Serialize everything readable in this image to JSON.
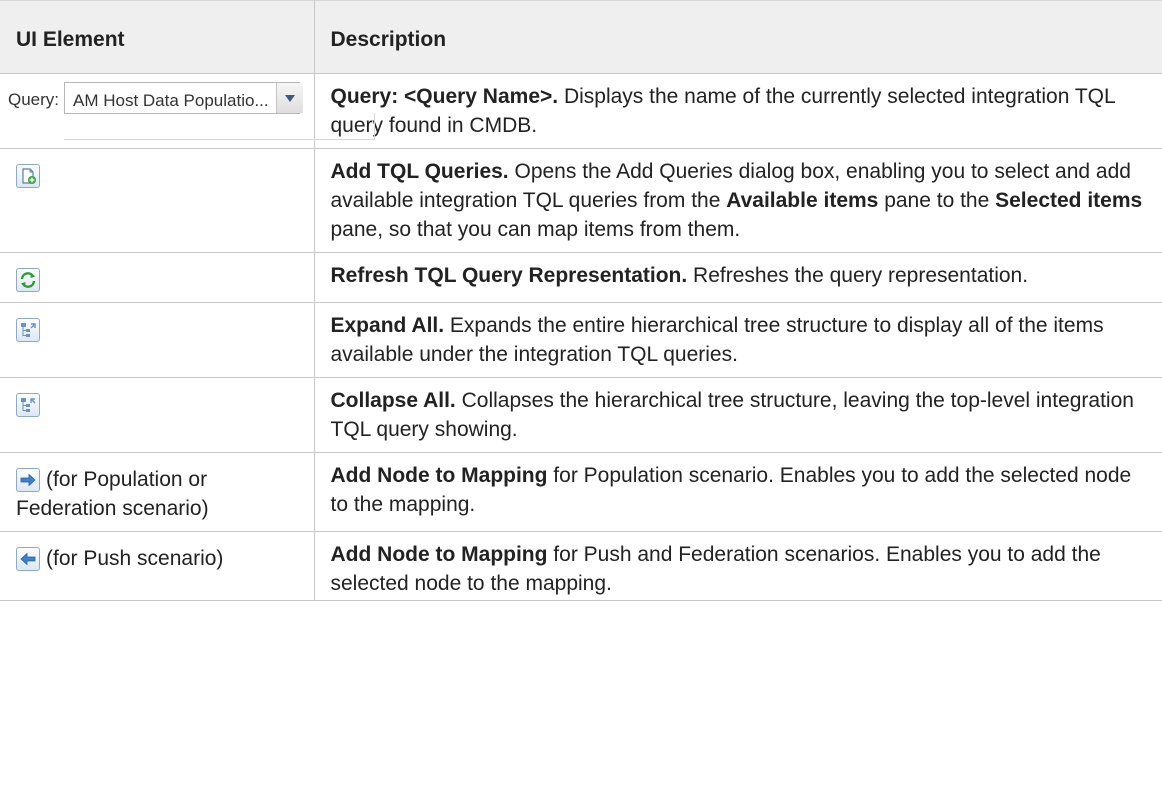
{
  "header": {
    "col1": "UI Element",
    "col2": "Description"
  },
  "query": {
    "label": "Query:",
    "value": "AM Host Data Populatio...",
    "title": "Query: <Query Name>.",
    "desc": " Displays the name of the currently selected integration TQL query found in CMDB."
  },
  "rows": [
    {
      "icon": "add-query-icon",
      "title": "Add TQL Queries.",
      "desc1": " Opens the Add Queries dialog box, enabling you to select and add available integration TQL queries from the ",
      "bold1": "Available items",
      "desc2": " pane to the ",
      "bold2": "Selected items",
      "desc3": " pane, so that you can map items from them."
    },
    {
      "icon": "refresh-icon",
      "title": "Refresh TQL Query Representation.",
      "desc": " Refreshes the query representation."
    },
    {
      "icon": "expand-all-icon",
      "title": "Expand All.",
      "desc": " Expands the entire hierarchical tree structure to display all of the items available under the integration TQL queries."
    },
    {
      "icon": "collapse-all-icon",
      "title": "Collapse All.",
      "desc": " Collapses the hierarchical tree structure, leaving the top-level integration TQL query showing."
    },
    {
      "icon": "arrow-right-icon",
      "element_text": "(for Population or Federation scenario)",
      "title": "Add Node to Mapping",
      "desc": " for Population scenario. Enables you to add the selected node to the mapping."
    },
    {
      "icon": "arrow-left-icon",
      "element_text": "(for Push scenario)",
      "title": "Add Node to Mapping",
      "desc": " for Push and Federation scenarios. Enables you to add the selected node to the mapping."
    }
  ]
}
